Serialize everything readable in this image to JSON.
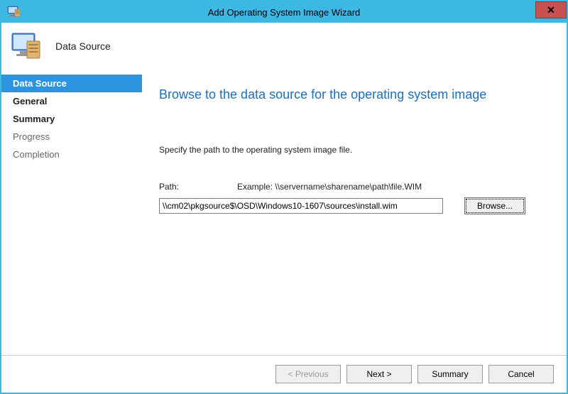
{
  "window": {
    "title": "Add Operating System Image Wizard",
    "close_glyph": "✕"
  },
  "header": {
    "stage_title": "Data Source"
  },
  "sidebar": {
    "steps": [
      {
        "label": "Data Source",
        "active": true,
        "bold": true,
        "dim": false
      },
      {
        "label": "General",
        "active": false,
        "bold": true,
        "dim": false
      },
      {
        "label": "Summary",
        "active": false,
        "bold": true,
        "dim": false
      },
      {
        "label": "Progress",
        "active": false,
        "bold": false,
        "dim": true
      },
      {
        "label": "Completion",
        "active": false,
        "bold": false,
        "dim": true
      }
    ]
  },
  "main": {
    "heading": "Browse to the data source for the operating system image",
    "instruction": "Specify the path to the operating system image file.",
    "path_label": "Path:",
    "path_example": "Example:  \\\\servername\\sharename\\path\\file.WIM",
    "path_value": "\\\\cm02\\pkgsource$\\OSD\\Windows10-1607\\sources\\install.wim",
    "browse_label": "Browse..."
  },
  "footer": {
    "previous": "< Previous",
    "next": "Next >",
    "summary": "Summary",
    "cancel": "Cancel"
  }
}
